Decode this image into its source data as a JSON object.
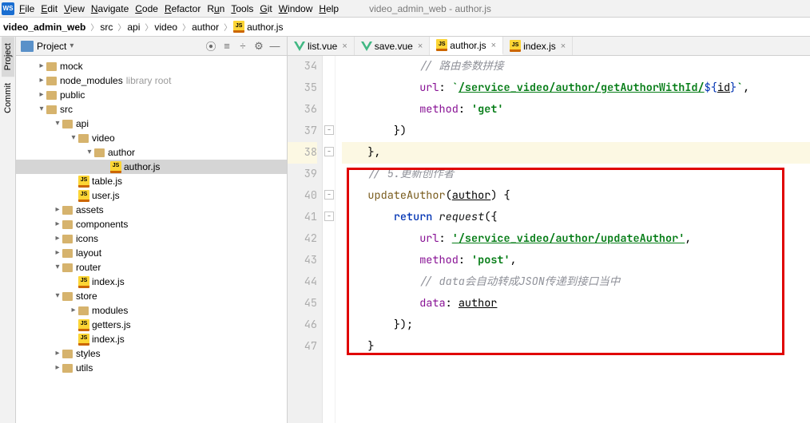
{
  "menu": {
    "file": "File",
    "edit": "Edit",
    "view": "View",
    "navigate": "Navigate",
    "code": "Code",
    "refactor": "Refactor",
    "run": "Run",
    "tools": "Tools",
    "git": "Git",
    "window": "Window",
    "help": "Help"
  },
  "title_right": "video_admin_web - author.js",
  "breadcrumb": {
    "root": "video_admin_web",
    "p1": "src",
    "p2": "api",
    "p3": "video",
    "p4": "author",
    "file": "author.js"
  },
  "leftbar": {
    "project": "Project",
    "commit": "Commit"
  },
  "project_panel": {
    "title": "Project",
    "sel_arrow": "▾"
  },
  "tree": {
    "mock": "mock",
    "node_modules": "node_modules",
    "lib_root": "library root",
    "public": "public",
    "src": "src",
    "api": "api",
    "video": "video",
    "author_folder": "author",
    "author_js": "author.js",
    "table_js": "table.js",
    "user_js": "user.js",
    "assets": "assets",
    "components": "components",
    "icons": "icons",
    "layout": "layout",
    "router": "router",
    "index_js": "index.js",
    "store": "store",
    "modules": "modules",
    "getters_js": "getters.js",
    "store_index_js": "index.js",
    "styles": "styles",
    "utils": "utils"
  },
  "tabs": {
    "list": "list.vue",
    "save": "save.vue",
    "author": "author.js",
    "index": "index.js"
  },
  "code": {
    "ln34": "34",
    "ln35": "35",
    "ln36": "36",
    "ln37": "37",
    "ln38": "38",
    "ln39": "39",
    "ln40": "40",
    "ln41": "41",
    "ln42": "42",
    "ln43": "43",
    "ln44": "44",
    "ln45": "45",
    "ln46": "46",
    "ln47": "47",
    "comment_route": "// 路由参数拼接",
    "url_get_pre": "url: `",
    "url_get_link": "/service_video/author/getAuthorWithId/",
    "tpl_open": "${",
    "id_var": "id",
    "tpl_close": "}",
    "post_tpl_back": "`,",
    "method_lbl": "method:",
    "get_str": "'get'",
    "close_obj": "})",
    "close_brace_c": "},",
    "comment5": "// 5.更新创作者",
    "updateAuthor": "updateAuthor",
    "author_param": "author",
    "paren_brace": ") {",
    "return_kw": "return",
    "request_fn": "request",
    "req_open": "({",
    "url_lbl": "url:",
    "upd_url": "'/service_video/author/updateAuthor'",
    "post_str": "'post'",
    "comma": ",",
    "data_comment": "// data会自动转成JSON传递到接口当中",
    "data_lbl": "data:",
    "author_ref": "author",
    "close_req": "});",
    "close_fn": "}",
    "close_mod": "}"
  }
}
